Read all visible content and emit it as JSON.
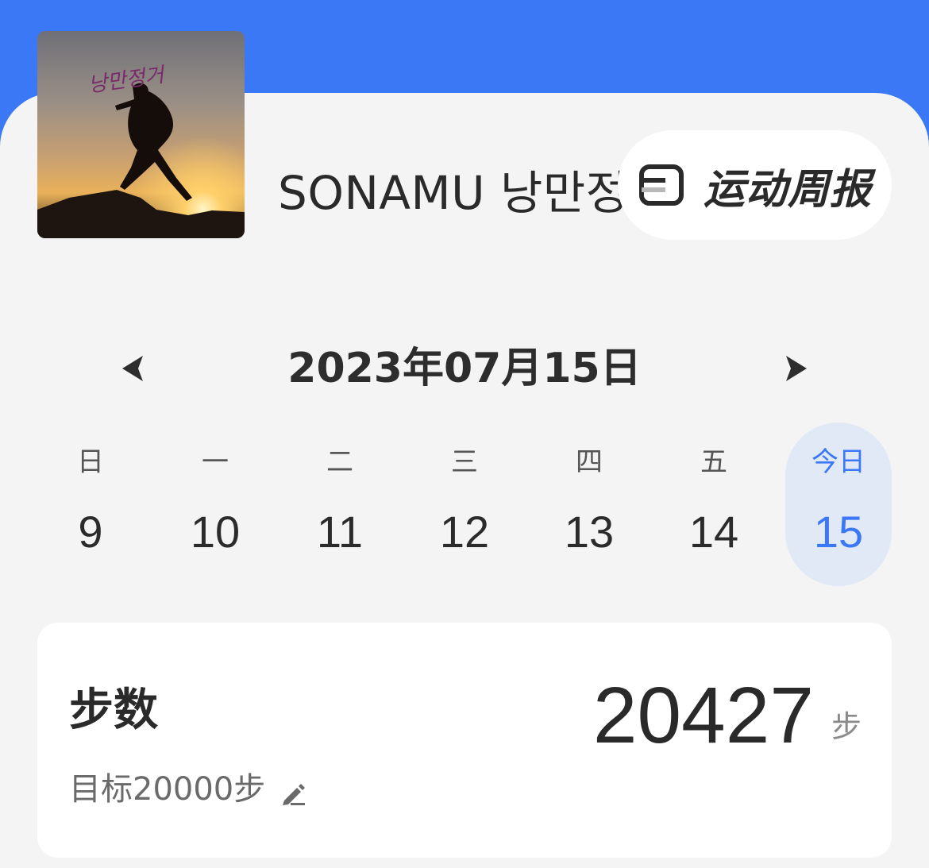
{
  "profile": {
    "name": "SONAMU 낭만정",
    "avatar_caption": "낭만정거",
    "avatar_icon": "album-cover-image"
  },
  "header": {
    "weekly_report_label": "运动周报",
    "weekly_report_icon": "report-icon"
  },
  "date_nav": {
    "title": "2023年07月15日",
    "prev_icon": "chevron-left-icon",
    "next_icon": "chevron-right-icon"
  },
  "week": {
    "days": [
      {
        "weekday": "日",
        "num": "9",
        "active": false
      },
      {
        "weekday": "一",
        "num": "10",
        "active": false
      },
      {
        "weekday": "二",
        "num": "11",
        "active": false
      },
      {
        "weekday": "三",
        "num": "12",
        "active": false
      },
      {
        "weekday": "四",
        "num": "13",
        "active": false
      },
      {
        "weekday": "五",
        "num": "14",
        "active": false
      },
      {
        "weekday": "今日",
        "num": "15",
        "active": true
      }
    ]
  },
  "steps": {
    "title": "步数",
    "value": "20427",
    "unit": "步",
    "goal": "目标20000步",
    "edit_icon": "pencil-icon"
  },
  "colors": {
    "accent": "#3b78f6",
    "active_day_bg": "#e2e9f6",
    "background": "#f4f4f4"
  }
}
